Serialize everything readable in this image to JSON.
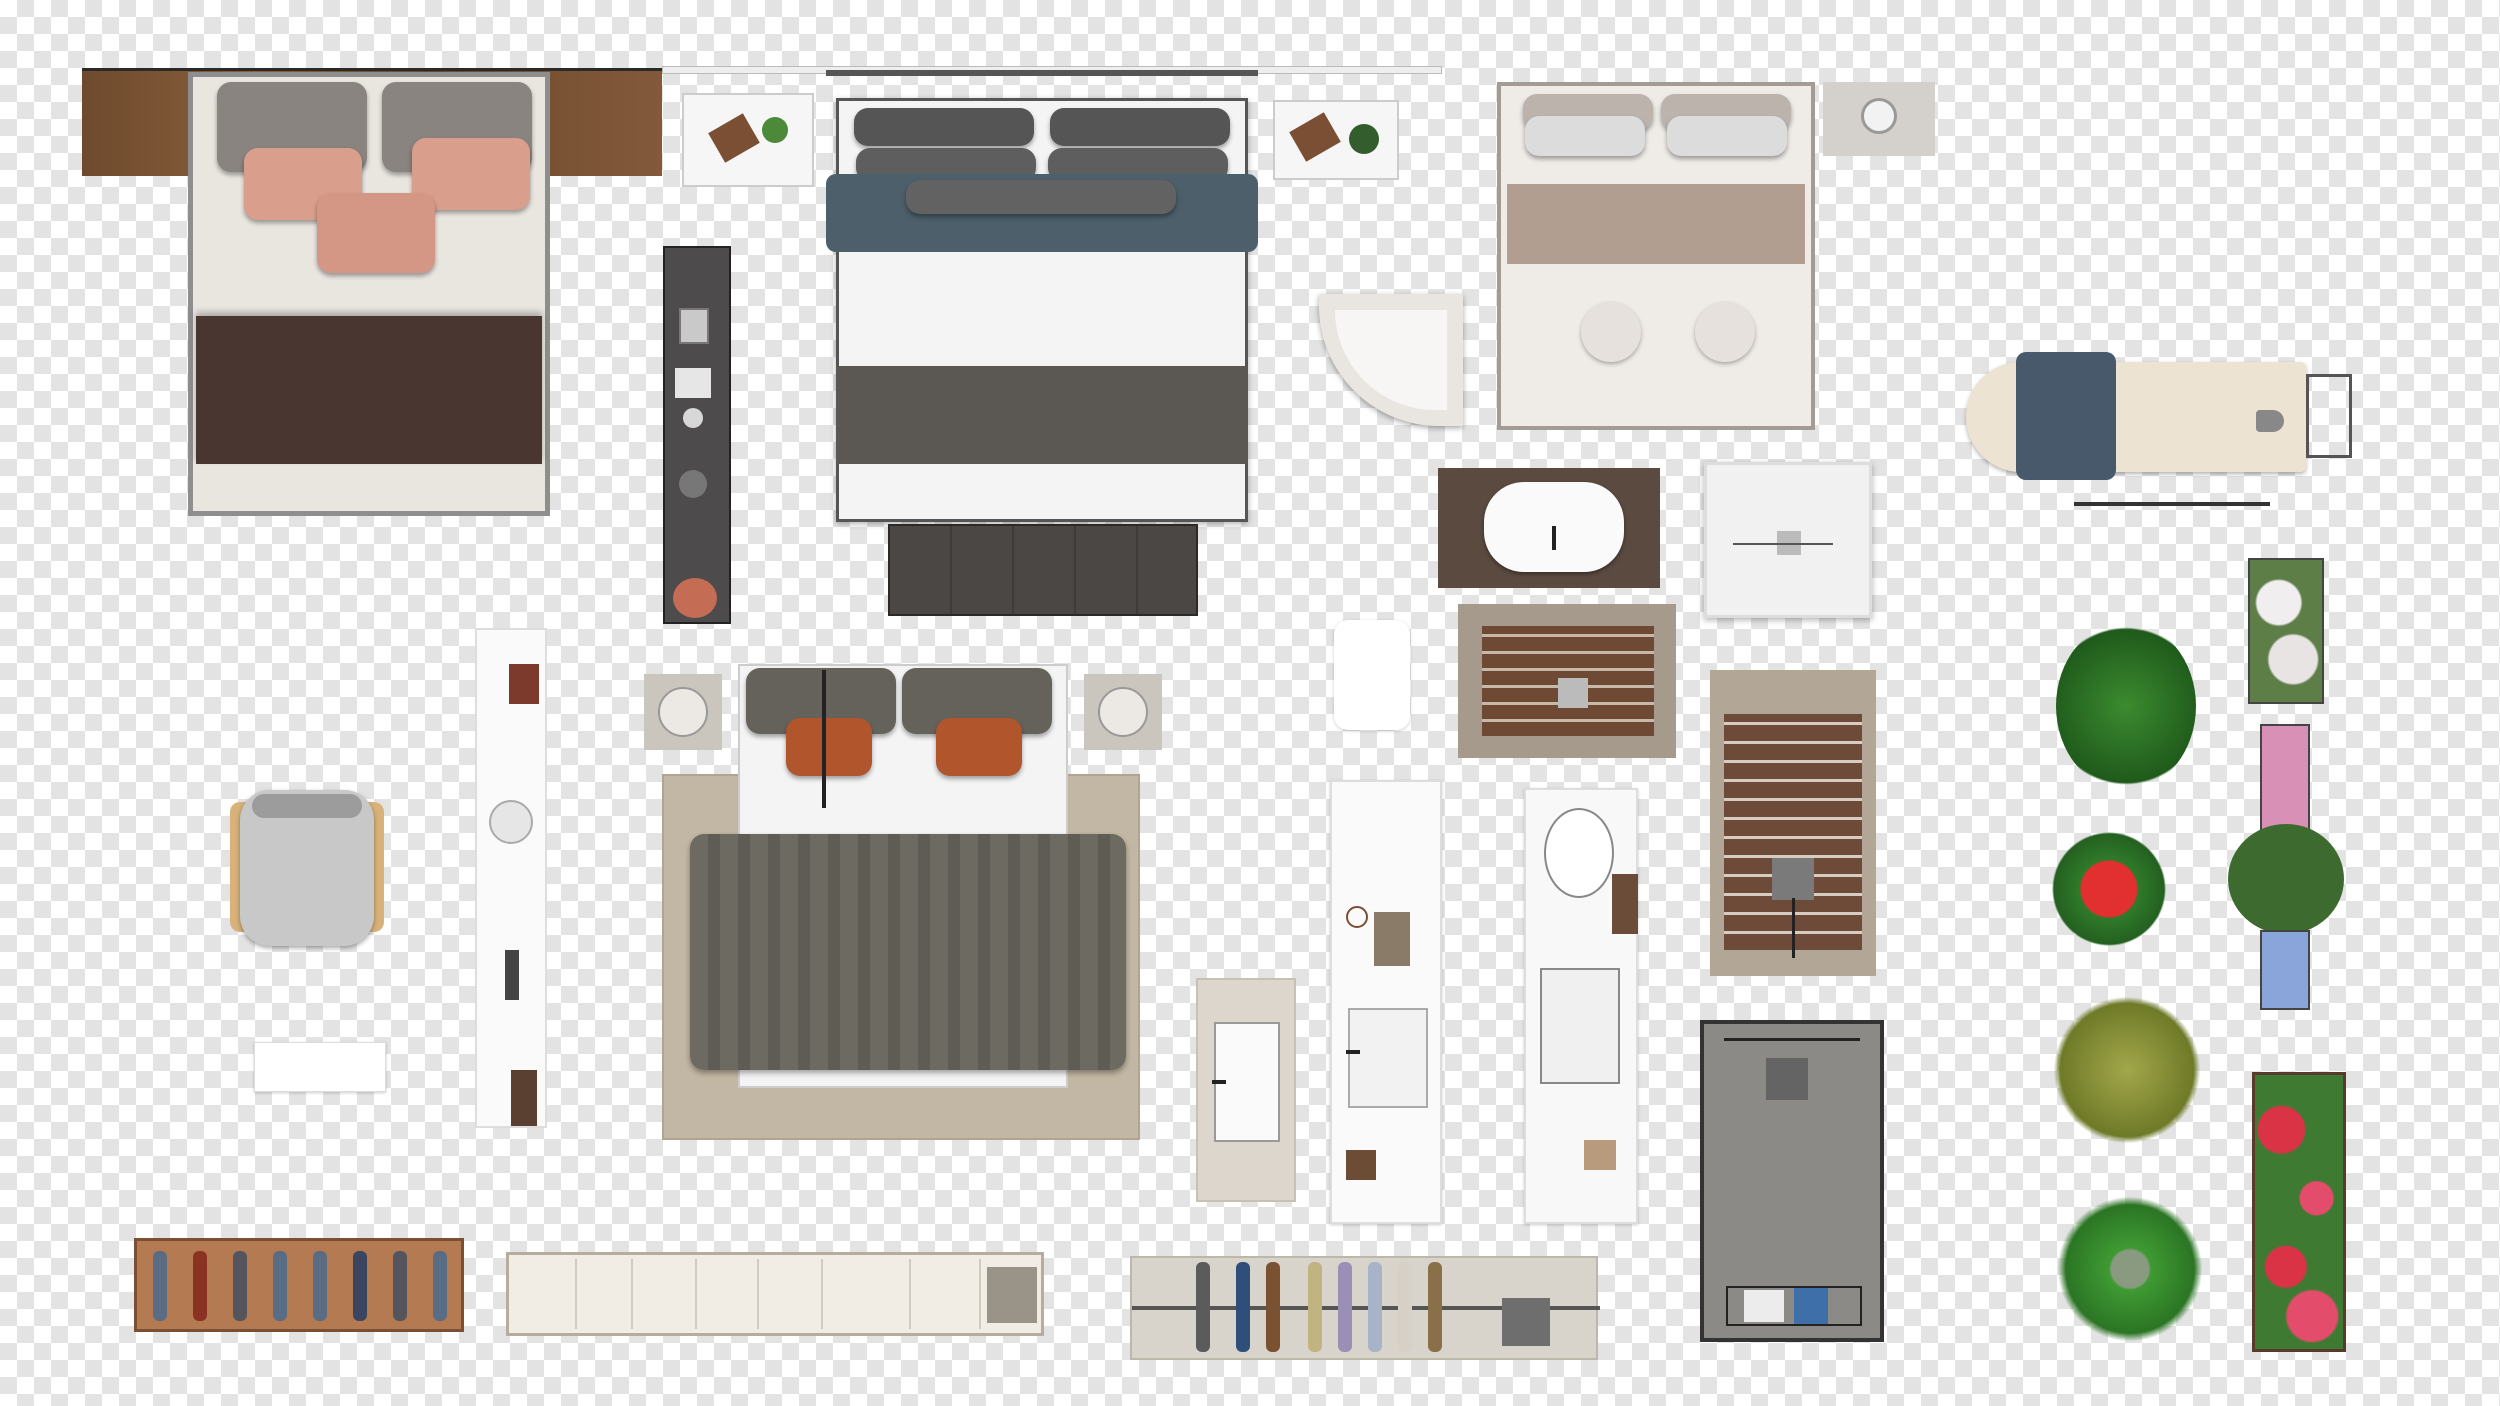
{
  "canvas": {
    "checker_light": "#ffffff",
    "checker_dark": "#e3e3e3"
  },
  "objects": [
    {
      "name": "double-bed-brown-blanket",
      "colors": {
        "frame": "#7a5232",
        "sheet": "#e9e5df",
        "pillow": "#d99f8c",
        "blanket": "#4a3631"
      }
    },
    {
      "name": "king-bed-grey-striped",
      "colors": {
        "throw": "#4c5f6a",
        "band": "#5b5752",
        "bench": "#4a4744"
      }
    },
    {
      "name": "double-bed-beige",
      "colors": {
        "quilt": "#b19e90",
        "sheet": "#efece8"
      }
    },
    {
      "name": "bed-olive-throw-on-rug",
      "colors": {
        "rug": "#c2b7a4",
        "throw": "#6d6a62",
        "cushion": "#b0552c"
      }
    },
    {
      "name": "ironing-board",
      "colors": {
        "board": "#ede3d2"
      }
    },
    {
      "name": "corner-shower-tray",
      "colors": {
        "tray": "#e9e6e2"
      }
    },
    {
      "name": "vessel-sink-vanity",
      "colors": {
        "counter": "#5b4a40"
      }
    },
    {
      "name": "square-shower-tray",
      "colors": {
        "tray": "#f1f1f1"
      }
    },
    {
      "name": "wooden-bath-mat",
      "colors": {
        "slats": "#6e4a35"
      }
    },
    {
      "name": "teak-shower-floor",
      "colors": {
        "slats": "#6d4b38"
      }
    },
    {
      "name": "concrete-shower",
      "colors": {
        "floor": "#8c8a86"
      }
    },
    {
      "name": "plants",
      "colors": {
        "leaf": "#2f7a2a",
        "red": "#cc1f24",
        "olive": "#7f8b30"
      }
    },
    {
      "name": "planter-boxes",
      "colors": {
        "pink": "#d990b6",
        "blue": "#8aa5d9",
        "red": "#d93345"
      }
    },
    {
      "name": "wardrobe-rails",
      "colors": {
        "wood": "#b47a52",
        "rail": "#d9d4cb"
      }
    }
  ]
}
